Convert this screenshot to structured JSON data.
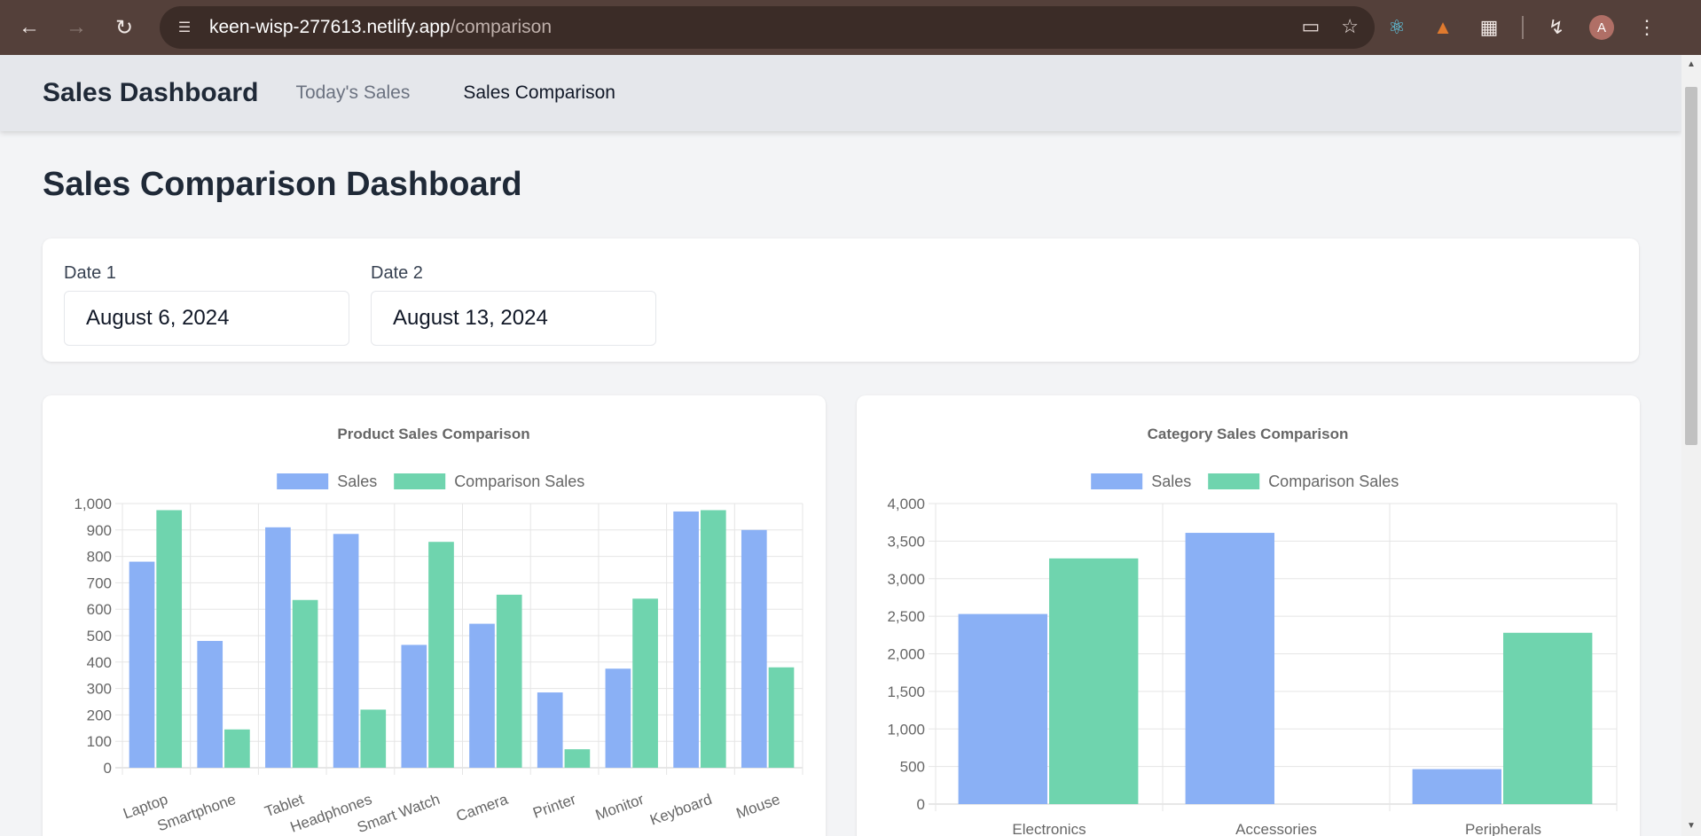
{
  "browser": {
    "url_host": "keen-wisp-277613.netlify.app",
    "url_path": "/comparison",
    "avatar_letter": "A"
  },
  "nav": {
    "brand": "Sales Dashboard",
    "links": [
      "Today's Sales",
      "Sales Comparison"
    ]
  },
  "page": {
    "title": "Sales Comparison Dashboard"
  },
  "dates": {
    "date1_label": "Date 1",
    "date1_value": "August 6, 2024",
    "date2_label": "Date 2",
    "date2_value": "August 13, 2024"
  },
  "colors": {
    "sales": "#8ab0f5",
    "comparison": "#6fd4ae",
    "grid": "#e5e5e5",
    "text": "#666666"
  },
  "chart_data": [
    {
      "type": "bar",
      "title": "Product Sales Comparison",
      "categories": [
        "Laptop",
        "Smartphone",
        "Tablet",
        "Headphones",
        "Smart Watch",
        "Camera",
        "Printer",
        "Monitor",
        "Keyboard",
        "Mouse"
      ],
      "series": [
        {
          "name": "Sales",
          "values": [
            780,
            480,
            910,
            885,
            465,
            545,
            285,
            375,
            970,
            900
          ]
        },
        {
          "name": "Comparison Sales",
          "values": [
            975,
            145,
            635,
            220,
            855,
            655,
            70,
            640,
            975,
            380
          ]
        }
      ],
      "ylim": [
        0,
        1000
      ],
      "yticks": [
        "1,000",
        "900",
        "800",
        "700",
        "600",
        "500",
        "400",
        "300",
        "200",
        "100",
        "0"
      ],
      "legend": "top-center",
      "grid": true
    },
    {
      "type": "bar",
      "title": "Category Sales Comparison",
      "categories": [
        "Electronics",
        "Accessories",
        "Peripherals"
      ],
      "series": [
        {
          "name": "Sales",
          "values": [
            2530,
            3610,
            465
          ]
        },
        {
          "name": "Comparison Sales",
          "values": [
            3270,
            0,
            2280
          ]
        }
      ],
      "ylim": [
        0,
        4000
      ],
      "yticks": [
        "4,000",
        "3,500",
        "3,000",
        "2,500",
        "2,000",
        "1,500",
        "1,000",
        "500",
        "0"
      ],
      "legend": "top-center",
      "grid": true
    }
  ]
}
